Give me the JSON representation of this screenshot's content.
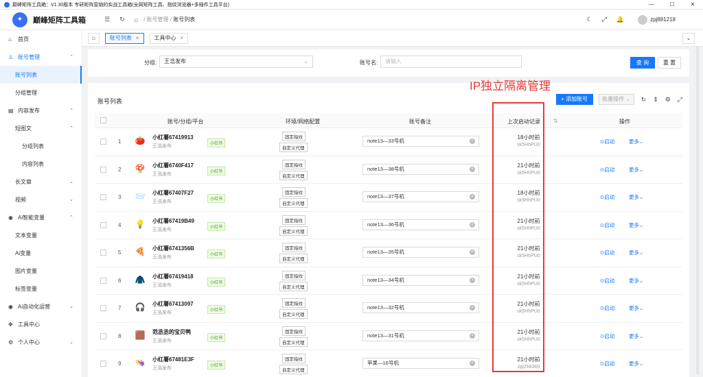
{
  "window": {
    "title": "巅峰矩阵工具箱：V1.30版本  专研矩阵营销的实战工具箱(全网矩阵工具、指纹浏览器+多插件工具平台)",
    "buttons": [
      "—",
      "☐",
      "✕"
    ]
  },
  "header": {
    "app_name": "巅峰矩阵工具箱",
    "breadcrumb": [
      "账号管理",
      "账号列表"
    ],
    "breadcrumb_sep": "/",
    "username": "zpj881218"
  },
  "sidebar": {
    "items": [
      {
        "label": "首页",
        "icon": "⌂",
        "level": 0
      },
      {
        "label": "账号管理",
        "icon": "♙",
        "level": 0,
        "chev": "⌃"
      },
      {
        "label": "账号列表",
        "level": 1,
        "active": true
      },
      {
        "label": "分组管理",
        "level": 1
      },
      {
        "label": "内容发布",
        "icon": "▤",
        "level": 0,
        "chev": "⌃"
      },
      {
        "label": "短图文",
        "level": 1,
        "chev": "⌃"
      },
      {
        "label": "分组列表",
        "level": 2
      },
      {
        "label": "内容列表",
        "level": 2
      },
      {
        "label": "长文章",
        "level": 1,
        "chev": "⌄"
      },
      {
        "label": "视频",
        "level": 1,
        "chev": "⌄"
      },
      {
        "label": "Ai智能变量",
        "icon": "◉",
        "level": 0,
        "chev": "⌃"
      },
      {
        "label": "文本变量",
        "level": 1
      },
      {
        "label": "Ai变量",
        "level": 1
      },
      {
        "label": "图片变量",
        "level": 1
      },
      {
        "label": "标签变量",
        "level": 1
      },
      {
        "label": "Ai自动化运营",
        "icon": "◉",
        "level": 0,
        "chev": "⌄"
      },
      {
        "label": "工具中心",
        "icon": "✥",
        "level": 0
      },
      {
        "label": "个人中心",
        "icon": "⚙",
        "level": 0,
        "chev": "⌄"
      }
    ]
  },
  "tabs": [
    {
      "label": "账号列表",
      "active": true,
      "close": "×"
    },
    {
      "label": "工具中心",
      "active": false,
      "close": "×"
    }
  ],
  "filter": {
    "group_label": "分组:",
    "group_value": "王浩发布",
    "account_label": "账号名:",
    "account_placeholder": "请输入",
    "search_label": "查 询",
    "reset_label": "重 置"
  },
  "panel": {
    "title": "账号列表",
    "add_label": "+ 添加账号",
    "batch_label": "批量操作 ⌄"
  },
  "annotation": "IP独立隔离管理",
  "table": {
    "headers": {
      "account": "账号/分组/平台",
      "env": "环境/网络配置",
      "note": "账号备注",
      "last": "上次启动记录",
      "ops": "操作"
    },
    "rows": [
      {
        "idx": "1",
        "emoji": "🍅",
        "name": "小红薯67419913",
        "group": "王浩发布",
        "platform": "小红书",
        "fp": "固定指纹",
        "proxy": "自定义代理",
        "note": "note13—33号机",
        "time": "18小时前",
        "code": "sk5HhPU0",
        "start": "⊙启动",
        "more": "更多⌄"
      },
      {
        "idx": "2",
        "emoji": "🍄",
        "name": "小红薯6740F417",
        "group": "王浩发布",
        "platform": "小红书",
        "fp": "固定指纹",
        "proxy": "自定义代理",
        "note": "note13—38号机",
        "time": "21小时前",
        "code": "sk5HhPU0",
        "start": "⊙启动",
        "more": "更多⌄"
      },
      {
        "idx": "3",
        "emoji": "📨",
        "name": "小红薯67407F27",
        "group": "王浩发布",
        "platform": "小红书",
        "fp": "固定指纹",
        "proxy": "自定义代理",
        "note": "note13—37号机",
        "time": "18小时前",
        "code": "sk5HhPU0",
        "start": "⊙启动",
        "more": "更多⌄"
      },
      {
        "idx": "4",
        "emoji": "💡",
        "name": "小红薯67419B49",
        "group": "王浩发布",
        "platform": "小红书",
        "fp": "固定指纹",
        "proxy": "自定义代理",
        "note": "note13—36号机",
        "time": "21小时前",
        "code": "sk5HhPU0",
        "start": "⊙启动",
        "more": "更多⌄"
      },
      {
        "idx": "5",
        "emoji": "🍕",
        "name": "小红薯6741356B",
        "group": "王浩发布",
        "platform": "小红书",
        "fp": "固定指纹",
        "proxy": "自定义代理",
        "note": "note13—35号机",
        "time": "21小时前",
        "code": "sk5HhPU0",
        "start": "⊙启动",
        "more": "更多⌄"
      },
      {
        "idx": "6",
        "emoji": "🧥",
        "name": "小红薯67419418",
        "group": "王浩发布",
        "platform": "小红书",
        "fp": "固定指纹",
        "proxy": "自定义代理",
        "note": "note13—34号机",
        "time": "21小时前",
        "code": "sk5HhPU0",
        "start": "⊙启动",
        "more": "更多⌄"
      },
      {
        "idx": "7",
        "emoji": "🎧",
        "name": "小红薯67413097",
        "group": "王浩发布",
        "platform": "小红书",
        "fp": "固定指纹",
        "proxy": "自定义代理",
        "note": "note13—32号机",
        "time": "21小时前",
        "code": "sk5HhPU0",
        "start": "⊙启动",
        "more": "更多⌄"
      },
      {
        "idx": "8",
        "emoji": "🟫",
        "name": "范丞丞的宝贝鸭",
        "group": "王浩发布",
        "platform": "小红书",
        "fp": "固定指纹",
        "proxy": "自定义代理",
        "note": "note13—31号机",
        "time": "21小时前",
        "code": "sk5HhPU0",
        "start": "⊙启动",
        "more": "更多⌄"
      },
      {
        "idx": "9",
        "emoji": "👒",
        "name": "小红薯67481E3F",
        "group": "王浩发布",
        "platform": "小红书",
        "fp": "固定指纹",
        "proxy": "自定义代理",
        "note": "苹果—16号机",
        "time": "21小时前",
        "code": "zpj258369",
        "start": "⊙启动",
        "more": "更多⌄"
      }
    ]
  }
}
